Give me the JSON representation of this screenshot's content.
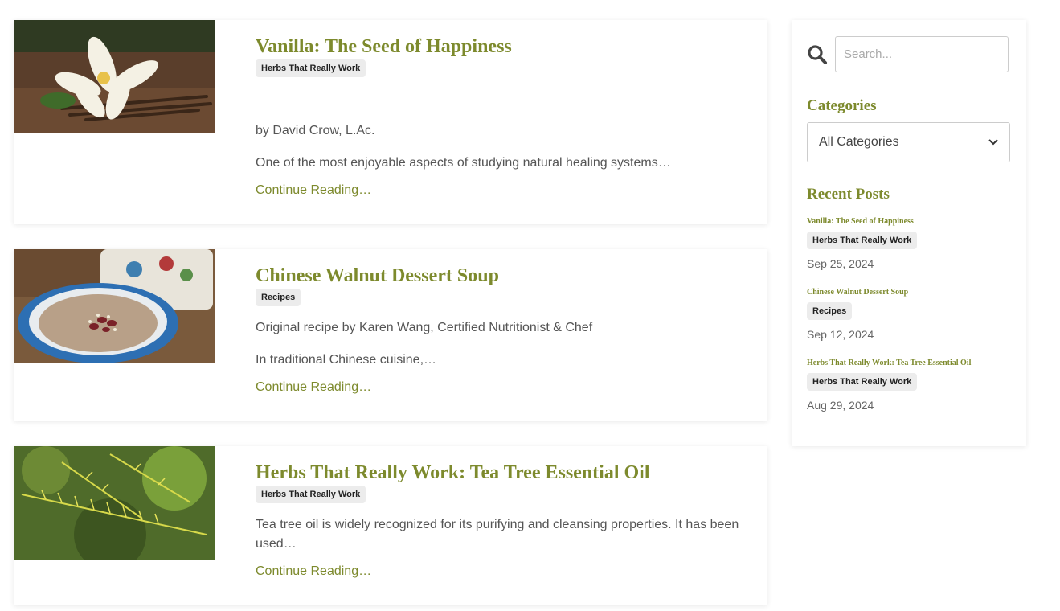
{
  "posts": [
    {
      "title": "Vanilla: The Seed of Happiness",
      "category": "Herbs That Really Work",
      "byline": "by David Crow, L.Ac.",
      "excerpt": "One of the most enjoyable aspects of studying natural healing systems…",
      "link": "Continue Reading…",
      "image_icon": "vanilla-flower-photo"
    },
    {
      "title": "Chinese Walnut Dessert Soup",
      "category": "Recipes",
      "byline": "Original recipe by Karen Wang, Certified Nutritionist & Chef",
      "excerpt": "In traditional Chinese cuisine,…",
      "link": "Continue Reading…",
      "image_icon": "soup-bowl-photo"
    },
    {
      "title": "Herbs That Really Work: Tea Tree Essential Oil",
      "category": "Herbs That Really Work",
      "excerpt": "Tea tree oil is widely recognized for its purifying and cleansing properties. It has been used…",
      "link": "Continue Reading…",
      "image_icon": "tea-tree-branch-photo"
    }
  ],
  "sidebar": {
    "search_placeholder": "Search...",
    "search_icon": "search-icon",
    "categories_heading": "Categories",
    "categories_selected": "All Categories",
    "recent_heading": "Recent Posts",
    "recent": [
      {
        "title": "Vanilla: The Seed of Happiness",
        "category": "Herbs That Really Work",
        "date": "Sep 25, 2024"
      },
      {
        "title": "Chinese Walnut Dessert Soup",
        "category": "Recipes",
        "date": "Sep 12, 2024"
      },
      {
        "title": "Herbs That Really Work: Tea Tree Essential Oil",
        "category": "Herbs That Really Work",
        "date": "Aug 29, 2024"
      }
    ]
  },
  "colors": {
    "accent": "#7d8a2d",
    "badge_bg": "#ececec",
    "text": "#555555"
  }
}
